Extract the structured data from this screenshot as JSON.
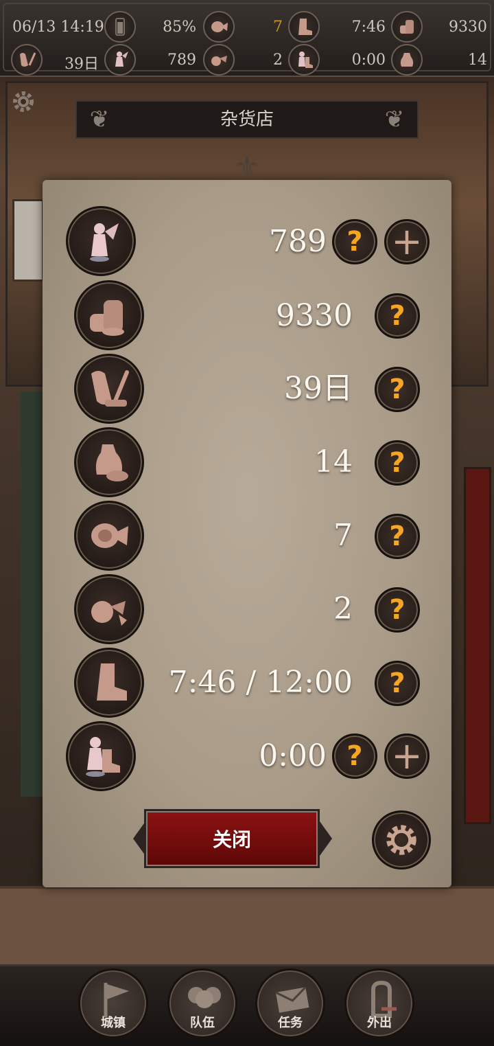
{
  "status_bar": {
    "datetime": "06/13 14:19",
    "battery": "85%",
    "meat_count": "7",
    "boot_time": "7:46",
    "coins": "9330",
    "days": "39日",
    "souls": "789",
    "ham_count": "2",
    "extra_time": "0:00",
    "bag_count": "14"
  },
  "header": {
    "title": "杂货店"
  },
  "resources": [
    {
      "icon": "fairy-statue-icon",
      "value": "789",
      "has_plus": true
    },
    {
      "icon": "coin-stack-icon",
      "value": "9330",
      "has_plus": false
    },
    {
      "icon": "scroll-quill-icon",
      "value": "39日",
      "has_plus": false
    },
    {
      "icon": "supply-bag-icon",
      "value": "14",
      "has_plus": false
    },
    {
      "icon": "meat-icon",
      "value": "7",
      "has_plus": false
    },
    {
      "icon": "ham-icon",
      "value": "2",
      "has_plus": false
    },
    {
      "icon": "boot-icon",
      "value": "7:46 / 12:00",
      "has_plus": false
    },
    {
      "icon": "fairy-boot-icon",
      "value": "0:00",
      "has_plus": true
    }
  ],
  "help_glyph": "?",
  "plus_glyph": "+",
  "modal": {
    "close_label": "关闭"
  },
  "nav": {
    "town": "城镇",
    "party": "队伍",
    "quest": "任务",
    "outing": "外出"
  },
  "colors": {
    "accent_help": "#f5a623",
    "close_button": "#8c1212",
    "parchment": "#ab9d8a"
  }
}
